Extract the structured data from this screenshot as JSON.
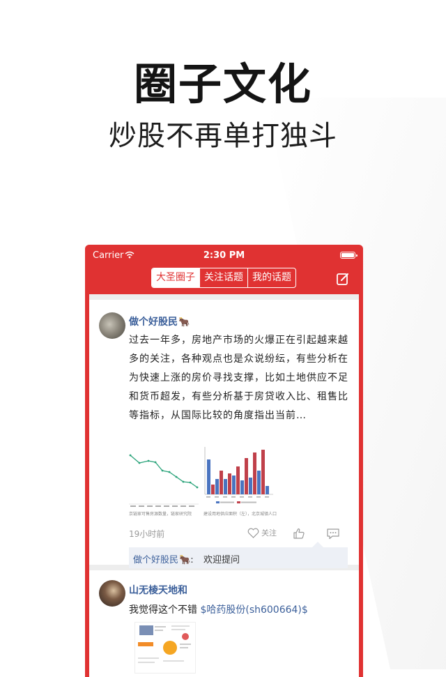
{
  "hero": {
    "title": "圈子文化",
    "subtitle": "炒股不再单打独斗"
  },
  "colors": {
    "accent": "#e03232",
    "link": "#3b5f9a",
    "reply_bg": "#edf0f6"
  },
  "status_bar": {
    "carrier": "Carrier",
    "time": "2:30 PM",
    "wifi_icon": "wifi-icon",
    "battery_icon": "battery-icon"
  },
  "nav": {
    "tabs": [
      {
        "label": "大圣圈子",
        "active": true
      },
      {
        "label": "关注话题",
        "active": false
      },
      {
        "label": "我的话题",
        "active": false
      }
    ],
    "compose_icon": "compose-icon"
  },
  "posts": [
    {
      "author": "做个好股民",
      "author_badge": "🐂",
      "text": "过去一年多，房地产市场的火爆正在引起越来越多的关注，各种观点也是众说纷纭，有些分析在为快速上涨的房价寻找支撑，比如土地供应不足和货币超发，有些分析基于房贷收入比、租售比等指标，从国际比较的角度指出当前…",
      "chart_captions": [
        "京链家可售房源数量，链家研究院",
        "建设用地供应面积（左），北京城镇人口"
      ],
      "time_ago": "19小时前",
      "follow_label": "关注",
      "reply": {
        "author": "做个好股民",
        "author_badge": "🐂",
        "separator": ":",
        "text": "欢迎提问"
      }
    },
    {
      "author": "山无棱天地和",
      "text_prefix": "我觉得这个不错",
      "stock_tag": "$哈药股份(sh600664)$"
    }
  ]
}
